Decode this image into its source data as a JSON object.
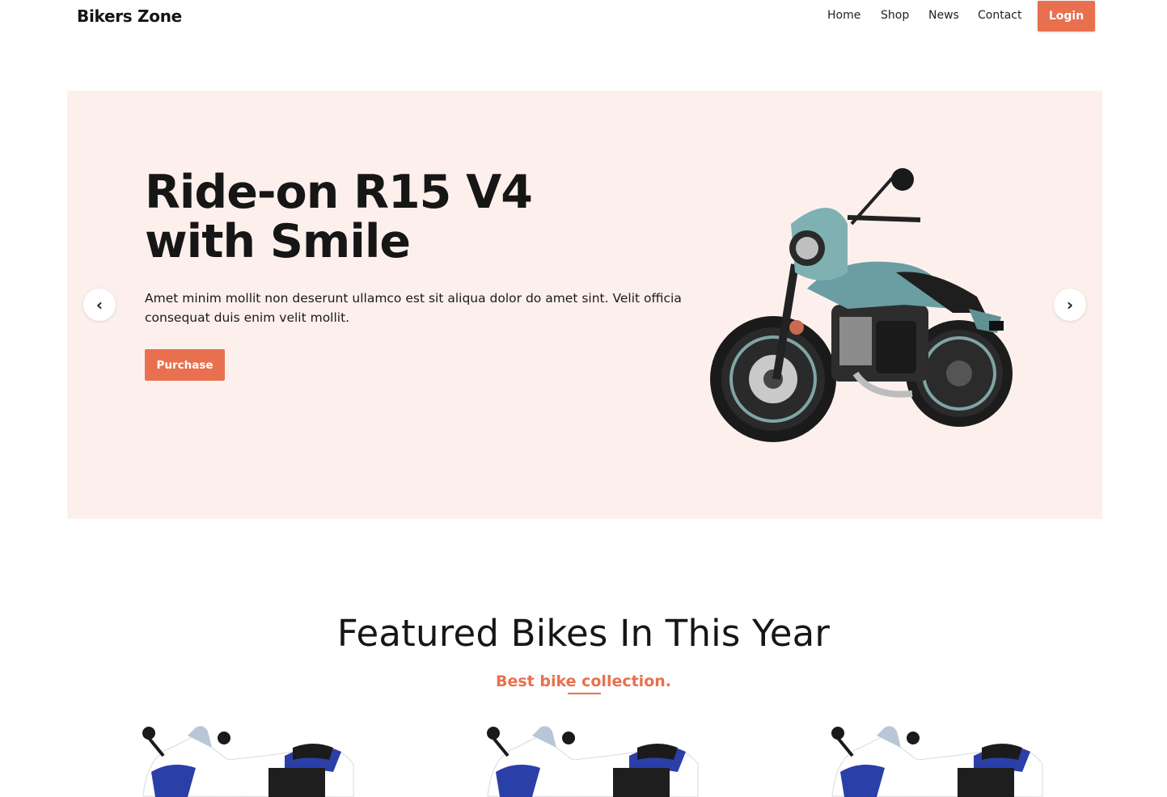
{
  "header": {
    "brand": "Bikers Zone",
    "nav": [
      "Home",
      "Shop",
      "News",
      "Contact"
    ],
    "login_label": "Login"
  },
  "hero": {
    "title_line1": "Ride-on R15 V4",
    "title_line2": "with Smile",
    "description": "Amet minim mollit non deserunt ullamco est sit aliqua dolor do amet sint. Velit officia consequat duis enim velit mollit.",
    "purchase_label": "Purchase",
    "prev_arrow": "‹",
    "next_arrow": "›",
    "background_color": "#fdf0ec"
  },
  "featured": {
    "title": "Featured Bikes In This Year",
    "subtitle": "Best bike collection."
  },
  "colors": {
    "accent": "#e8704e",
    "text": "#161616"
  },
  "icons": {
    "prev": "chevron-left-icon",
    "next": "chevron-right-icon"
  }
}
